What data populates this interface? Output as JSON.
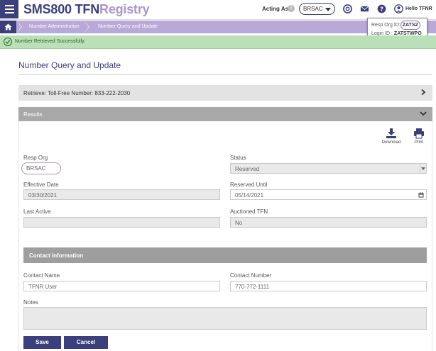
{
  "header": {
    "logo_main": "SMS800 TFN",
    "logo_accent": "Registry",
    "acting_as_label": "Acting As",
    "acting_as_value": "BRSAC",
    "greeting": "Hello TFNR"
  },
  "resp_org_popup": {
    "resp_org_label": "Resp Org ID:",
    "resp_org_value": "ZATS2",
    "login_label": "Login ID :",
    "login_value": "ZATSTWPO"
  },
  "breadcrumb": {
    "items": [
      "Number Administration",
      "Number Query and Update"
    ]
  },
  "banner": {
    "message": "Number Retrieved Successfully."
  },
  "page": {
    "title": "Number Query and Update",
    "retrieve_label": "Retrieve: Toll-Free Number: 833-222-2030",
    "results_label": "Results",
    "download_label": "Download",
    "print_label": "Print"
  },
  "form": {
    "resp_org": {
      "label": "Resp Org",
      "value": "BRSAC"
    },
    "status": {
      "label": "Status",
      "value": "Reserved"
    },
    "effective_date": {
      "label": "Effective Date",
      "value": "03/30/2021"
    },
    "reserved_until": {
      "label": "Reserved Until",
      "value": "05/14/2021"
    },
    "last_active": {
      "label": "Last Active",
      "value": ""
    },
    "auctioned_tfn": {
      "label": "Auctioned TFN",
      "value": "No"
    }
  },
  "contact": {
    "section_title": "Contact Information",
    "name": {
      "label": "Contact Name",
      "value": "TFNR User"
    },
    "number": {
      "label": "Contact Number",
      "value": "770-772-1111"
    },
    "notes": {
      "label": "Notes",
      "value": ""
    }
  },
  "actions": {
    "save_label": "Save",
    "cancel_label": "Cancel"
  },
  "colors": {
    "brand_primary": "#3b3f7c",
    "brand_accent": "#a897cf",
    "success_bg": "#b9e0b9"
  }
}
